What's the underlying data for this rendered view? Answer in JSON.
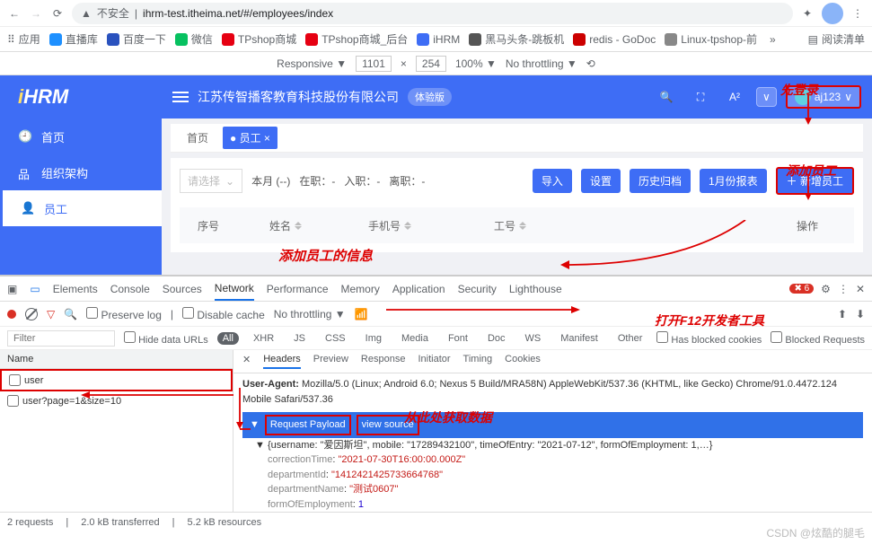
{
  "browser": {
    "insecure_label": "不安全",
    "url": "ihrm-test.itheima.net/#/employees/index"
  },
  "bookmarks": {
    "apps": "应用",
    "items": [
      "直播库",
      "百度一下",
      "微信",
      "TPshop商城",
      "TPshop商城_后台",
      "iHRM",
      "黑马头条-跳板机",
      "redis - GoDoc",
      "Linux-tpshop-前"
    ],
    "read_list": "阅读清单"
  },
  "device_bar": {
    "mode": "Responsive",
    "w": "1101",
    "x": "×",
    "h": "254",
    "zoom": "100%",
    "throttle": "No throttling"
  },
  "app": {
    "logo": "HRM",
    "company": "江苏传智播客教育科技股份有限公司",
    "trial": "体验版",
    "user": "aj123",
    "nav": [
      "首页",
      "组织架构",
      "员工"
    ],
    "tabs": {
      "home": "首页",
      "employee": "● 员工 ×"
    },
    "toolbar": {
      "select_placeholder": "请选择",
      "month": "本月 (--)",
      "onjob": "在职：-",
      "join": "入职：-",
      "leave": "离职：-",
      "import": "导入",
      "settings": "设置",
      "history": "历史归档",
      "jan_report": "1月份报表",
      "add": "＋ 新增员工"
    },
    "table": {
      "seq": "序号",
      "name": "姓名",
      "phone": "手机号",
      "num": "工号",
      "op": "操作"
    }
  },
  "annotations": {
    "login_first": "先登录",
    "add_employee": "添加员工",
    "add_info": "添加员工的信息",
    "open_devtools": "打开F12开发者工具",
    "get_data": "从此处获取数据"
  },
  "devtools": {
    "tabs": [
      "Elements",
      "Console",
      "Sources",
      "Network",
      "Performance",
      "Memory",
      "Application",
      "Security",
      "Lighthouse"
    ],
    "errors": "6",
    "preserve": "Preserve log",
    "disable_cache": "Disable cache",
    "throttle": "No throttling",
    "filter_label": "Filter",
    "hide_data_urls": "Hide data URLs",
    "type_pills": [
      "All",
      "XHR",
      "JS",
      "CSS",
      "Img",
      "Media",
      "Font",
      "Doc",
      "WS",
      "Manifest",
      "Other"
    ],
    "blocked_cookies": "Has blocked cookies",
    "blocked_req": "Blocked Requests",
    "name_col": "Name",
    "requests": [
      "user",
      "user?page=1&size=10"
    ],
    "detail_tabs": [
      "Headers",
      "Preview",
      "Response",
      "Initiator",
      "Timing",
      "Cookies"
    ],
    "ua_label": "User-Agent:",
    "ua_val": "Mozilla/5.0 (Linux; Android 6.0; Nexus 5 Build/MRA58N) AppleWebKit/537.36 (KHTML, like Gecko) Chrome/91.0.4472.124 Mobile Safari/537.36",
    "payload_title": "Request Payload",
    "view_source": "view source",
    "payload_preview": "{username: \"爱因斯坦\", mobile: \"17289432100\", timeOfEntry: \"2021-07-12\", formOfEmployment: 1,…}",
    "fields": {
      "correctionTime": "\"2021-07-30T16:00:00.000Z\"",
      "departmentId": "\"1412421425733664768\"",
      "departmentName": "\"测试0607\"",
      "formOfEmployment": "1",
      "mobile": "\"17289432100\""
    },
    "status": [
      "2 requests",
      "2.0 kB transferred",
      "5.2 kB resources"
    ]
  },
  "watermark": "CSDN @炫酷的腿毛"
}
